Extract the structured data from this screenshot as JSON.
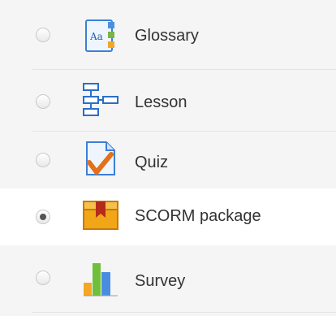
{
  "activity_chooser": {
    "items": [
      {
        "label": "Glossary",
        "icon": "glossary-icon",
        "selected": false
      },
      {
        "label": "Lesson",
        "icon": "lesson-icon",
        "selected": false
      },
      {
        "label": "Quiz",
        "icon": "quiz-icon",
        "selected": false
      },
      {
        "label": "SCORM package",
        "icon": "scorm-package-icon",
        "selected": true
      },
      {
        "label": "Survey",
        "icon": "survey-icon",
        "selected": false
      }
    ]
  }
}
